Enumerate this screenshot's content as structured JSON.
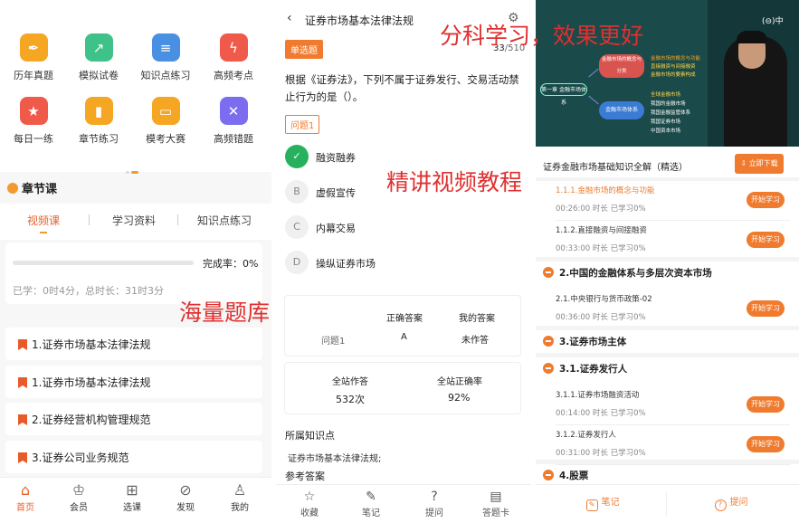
{
  "overlays": [
    "分科学习，效果更好",
    "精讲视频教程",
    "海量题库"
  ],
  "home": {
    "grid": [
      {
        "label": "历年真题",
        "icon": "pen-icon",
        "color": "#f5a623"
      },
      {
        "label": "模拟试卷",
        "icon": "chart-icon",
        "color": "#3ec28a"
      },
      {
        "label": "知识点练习",
        "icon": "doc-icon",
        "color": "#4a90e2"
      },
      {
        "label": "高频考点",
        "icon": "lightning-icon",
        "color": "#ef5a4a"
      },
      {
        "label": "每日一练",
        "icon": "star-icon",
        "color": "#ef5a4a"
      },
      {
        "label": "章节练习",
        "icon": "bookmark-icon",
        "color": "#f5a623"
      },
      {
        "label": "模考大赛",
        "icon": "monitor-icon",
        "color": "#f5a623"
      },
      {
        "label": "高频错题",
        "icon": "wrong-icon",
        "color": "#7b6cf0"
      }
    ],
    "section_title": "章节课",
    "tabs": [
      "视频课",
      "学习资料",
      "知识点练习"
    ],
    "completion_label": "完成率：0%",
    "completion_value": 0,
    "study_info": "已学：0时4分，总时长：31时3分",
    "chapters": [
      "1.证券市场基本法律法规",
      "1.证券市场基本法律法规",
      "2.证券经营机构管理规范",
      "3.证券公司业务规范"
    ],
    "nav": [
      {
        "label": "首页",
        "icon": "home-icon"
      },
      {
        "label": "会员",
        "icon": "crown-icon"
      },
      {
        "label": "选课",
        "icon": "grid-icon"
      },
      {
        "label": "发现",
        "icon": "compass-icon"
      },
      {
        "label": "我的",
        "icon": "user-icon"
      }
    ]
  },
  "quiz": {
    "title": "证券市场基本法律法规",
    "type_badge": "单选题",
    "count_current": "33",
    "count_total": "/510",
    "question": "根据《证券法》，下列不属于证券发行、交易活动禁止行为的是（）。",
    "question_tag": "问题1",
    "options": [
      {
        "key": "✓",
        "text": "融资融券",
        "correct": true
      },
      {
        "key": "B",
        "text": "虚假宣传",
        "correct": false
      },
      {
        "key": "C",
        "text": "内幕交易",
        "correct": false
      },
      {
        "key": "D",
        "text": "操纵证券市场",
        "correct": false
      }
    ],
    "answer_table": {
      "col_correct": "正确答案",
      "col_mine": "我的答案",
      "row_label": "问题1",
      "correct": "A",
      "mine": "未作答"
    },
    "stats": {
      "label_total": "全站作答",
      "label_rate": "全站正确率",
      "total": "532次",
      "rate": "92%"
    },
    "knowledge_title": "所属知识点",
    "knowledge_value": "证券市场基本法律法规;",
    "reference_title": "参考答案",
    "bottom": [
      {
        "label": "收藏",
        "icon": "star-icon"
      },
      {
        "label": "笔记",
        "icon": "note-icon"
      },
      {
        "label": "提问",
        "icon": "question-icon"
      },
      {
        "label": "答题卡",
        "icon": "card-icon"
      }
    ]
  },
  "course": {
    "brand": "(⊖)中",
    "video_texts": {
      "main": "第一章 金融市场体系",
      "node1": "金融市场的概念与分类",
      "node2": "金融市场体系",
      "lines": [
        "金融市场的概念与功能",
        "直接融资与间接融资",
        "金融市场的要素构成",
        "全球金融市场",
        "我国的金融市场",
        "我国金融监管体系",
        "我国证券市场",
        "中国资本市场"
      ]
    },
    "title": "证券金融市场基础知识全解（精选）",
    "download": "立即下载",
    "items": [
      {
        "kind": "lesson",
        "title": "1.1.1.金融市场的概念与功能",
        "meta": "00:26:00 时长  已学习0%",
        "btn": "开始学习",
        "active": true
      },
      {
        "kind": "lesson",
        "title": "1.1.2.直接融资与间接融资",
        "meta": "00:33:00 时长  已学习0%",
        "btn": "开始学习",
        "active": false
      },
      {
        "kind": "chapter",
        "title": "2.中国的金融体系与多层次资本市场"
      },
      {
        "kind": "lesson",
        "title": "2.1.中央银行与货币政策-02",
        "meta": "00:36:00 时长  已学习0%",
        "btn": "开始学习",
        "active": false
      },
      {
        "kind": "chapter",
        "title": "3.证券市场主体"
      },
      {
        "kind": "chapter",
        "title": "3.1.证券发行人"
      },
      {
        "kind": "lesson",
        "title": "3.1.1.证券市场融资活动",
        "meta": "00:14:00 时长  已学习0%",
        "btn": "开始学习",
        "active": false
      },
      {
        "kind": "lesson",
        "title": "3.1.2.证券发行人",
        "meta": "00:31:00 时长  已学习0%",
        "btn": "开始学习",
        "active": false
      },
      {
        "kind": "chapter",
        "title": "4.股票"
      }
    ],
    "bottom": [
      {
        "label": "笔记",
        "icon": "note-icon"
      },
      {
        "label": "提问",
        "icon": "question-icon"
      }
    ]
  }
}
